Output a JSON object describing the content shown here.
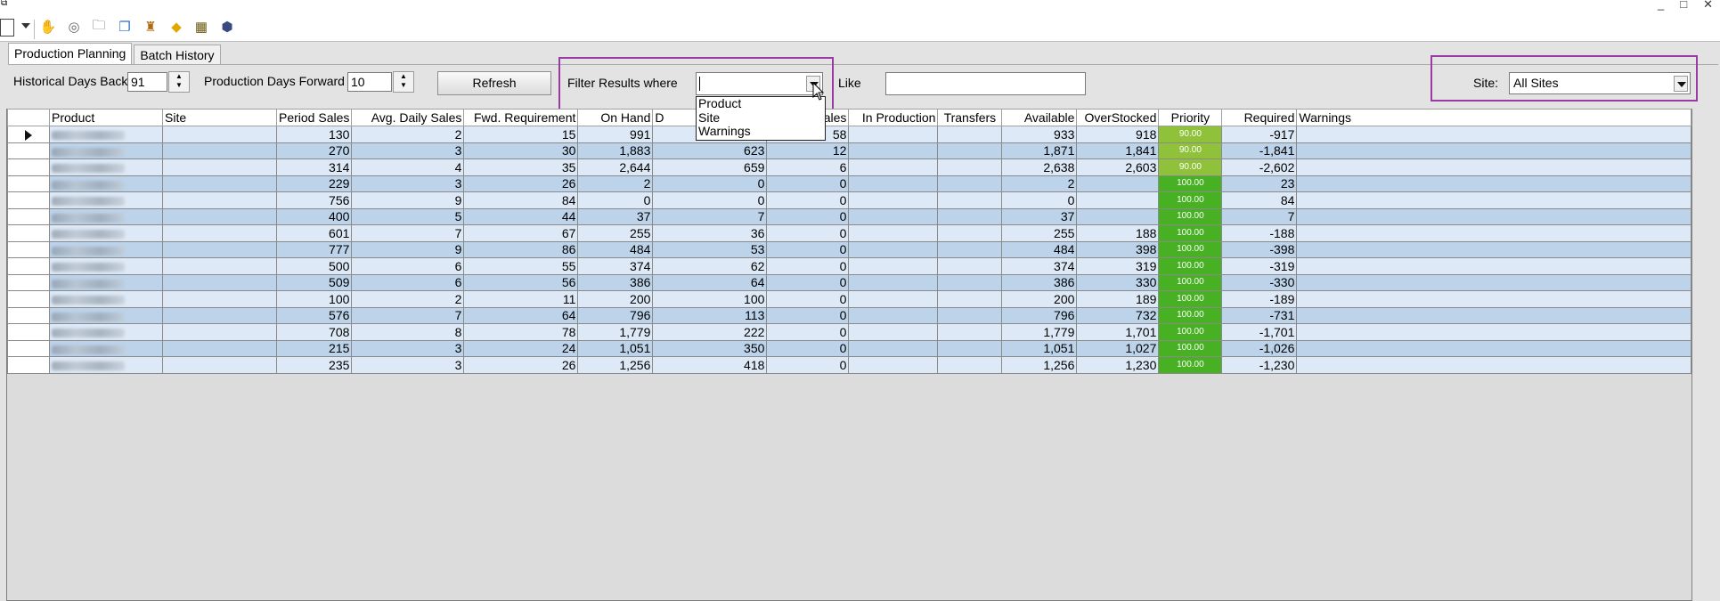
{
  "window": {
    "controls": [
      "_",
      "□",
      "✕"
    ]
  },
  "toolbar": {
    "icons": [
      "new-document-icon",
      "dropdown-arrow-icon",
      "hand-icon",
      "disc-icon",
      "folder-icon",
      "copy-icon",
      "chess-piece-icon",
      "diamond-sign-icon",
      "calculator-icon",
      "box-3d-icon"
    ]
  },
  "tabs": [
    {
      "label": "Production Planning",
      "active": true
    },
    {
      "label": "Batch History",
      "active": false
    }
  ],
  "controls": {
    "historical_label": "Historical Days Back",
    "historical_value": "91",
    "forward_label": "Production Days Forward",
    "forward_value": "10",
    "refresh_label": "Refresh",
    "filter_label": "Filter Results where",
    "filter_value": "",
    "like_label": "Like",
    "like_value": "",
    "site_label": "Site:",
    "site_value": "All Sites"
  },
  "filter_options": [
    "Product",
    "Site",
    "Warnings"
  ],
  "grid": {
    "columns": [
      "",
      "Product",
      "Site",
      "Period Sales",
      "Avg. Daily Sales",
      "Fwd. Requirement",
      "On Hand",
      "D",
      "ales",
      "In Production",
      "Transfers",
      "Available",
      "OverStocked",
      "Priority",
      "Required",
      "Warnings"
    ],
    "rows": [
      {
        "period": "130",
        "avg": "2",
        "fwd": "15",
        "onhand": "991",
        "d": "",
        "sales": "58",
        "avail": "933",
        "over": "918",
        "prio": "90.00",
        "req": "-917"
      },
      {
        "period": "270",
        "avg": "3",
        "fwd": "30",
        "onhand": "1,883",
        "d": "623",
        "sales": "12",
        "avail": "1,871",
        "over": "1,841",
        "prio": "90.00",
        "req": "-1,841"
      },
      {
        "period": "314",
        "avg": "4",
        "fwd": "35",
        "onhand": "2,644",
        "d": "659",
        "sales": "6",
        "avail": "2,638",
        "over": "2,603",
        "prio": "90.00",
        "req": "-2,602"
      },
      {
        "period": "229",
        "avg": "3",
        "fwd": "26",
        "onhand": "2",
        "d": "0",
        "sales": "0",
        "avail": "2",
        "over": "",
        "prio": "100.00",
        "req": "23"
      },
      {
        "period": "756",
        "avg": "9",
        "fwd": "84",
        "onhand": "0",
        "d": "0",
        "sales": "0",
        "avail": "0",
        "over": "",
        "prio": "100.00",
        "req": "84"
      },
      {
        "period": "400",
        "avg": "5",
        "fwd": "44",
        "onhand": "37",
        "d": "7",
        "sales": "0",
        "avail": "37",
        "over": "",
        "prio": "100.00",
        "req": "7"
      },
      {
        "period": "601",
        "avg": "7",
        "fwd": "67",
        "onhand": "255",
        "d": "36",
        "sales": "0",
        "avail": "255",
        "over": "188",
        "prio": "100.00",
        "req": "-188"
      },
      {
        "period": "777",
        "avg": "9",
        "fwd": "86",
        "onhand": "484",
        "d": "53",
        "sales": "0",
        "avail": "484",
        "over": "398",
        "prio": "100.00",
        "req": "-398"
      },
      {
        "period": "500",
        "avg": "6",
        "fwd": "55",
        "onhand": "374",
        "d": "62",
        "sales": "0",
        "avail": "374",
        "over": "319",
        "prio": "100.00",
        "req": "-319"
      },
      {
        "period": "509",
        "avg": "6",
        "fwd": "56",
        "onhand": "386",
        "d": "64",
        "sales": "0",
        "avail": "386",
        "over": "330",
        "prio": "100.00",
        "req": "-330"
      },
      {
        "period": "100",
        "avg": "2",
        "fwd": "11",
        "onhand": "200",
        "d": "100",
        "sales": "0",
        "avail": "200",
        "over": "189",
        "prio": "100.00",
        "req": "-189"
      },
      {
        "period": "576",
        "avg": "7",
        "fwd": "64",
        "onhand": "796",
        "d": "113",
        "sales": "0",
        "avail": "796",
        "over": "732",
        "prio": "100.00",
        "req": "-731"
      },
      {
        "period": "708",
        "avg": "8",
        "fwd": "78",
        "onhand": "1,779",
        "d": "222",
        "sales": "0",
        "avail": "1,779",
        "over": "1,701",
        "prio": "100.00",
        "req": "-1,701"
      },
      {
        "period": "215",
        "avg": "3",
        "fwd": "24",
        "onhand": "1,051",
        "d": "350",
        "sales": "0",
        "avail": "1,051",
        "over": "1,027",
        "prio": "100.00",
        "req": "-1,026"
      },
      {
        "period": "235",
        "avg": "3",
        "fwd": "26",
        "onhand": "1,256",
        "d": "418",
        "sales": "0",
        "avail": "1,256",
        "over": "1,230",
        "prio": "100.00",
        "req": "-1,230"
      }
    ]
  },
  "colors": {
    "highlight": "#9a3aa4",
    "row_light": "#dde9f6",
    "row_dark": "#bcd3ea",
    "priority_90": "#8fc23a",
    "priority_100": "#47b023"
  }
}
